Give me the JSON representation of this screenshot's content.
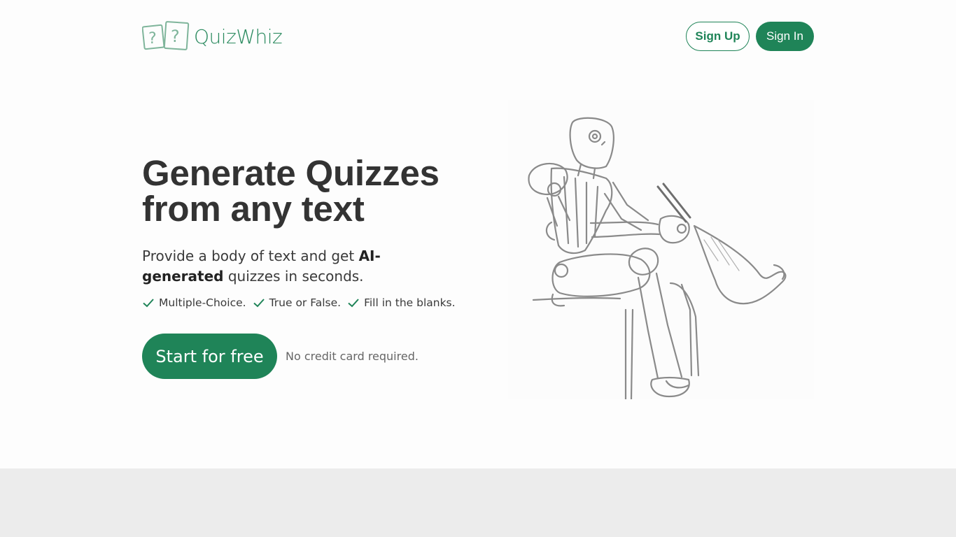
{
  "brand": {
    "name": "QuizWhiz",
    "accent": "#1f8458",
    "logo_icon": "question-cards-icon"
  },
  "header": {
    "signup_label": "Sign Up",
    "signin_label": "Sign In"
  },
  "hero": {
    "title_line1": "Generate Quizzes",
    "title_line2": "from any text",
    "subtitle_pre": "Provide a body of text and get ",
    "subtitle_bold": "AI-generated",
    "subtitle_post": " quizzes in seconds.",
    "features": [
      {
        "label": "Multiple-Choice.",
        "icon": "check-icon"
      },
      {
        "label": "True or False.",
        "icon": "check-icon"
      },
      {
        "label": "Fill in the blanks.",
        "icon": "check-icon"
      }
    ],
    "cta_label": "Start for free",
    "cta_note": "No credit card required.",
    "illustration": "robot-sketch-writing-on-scroll"
  },
  "colors": {
    "footer_band": "#ececec",
    "title": "#333333"
  }
}
